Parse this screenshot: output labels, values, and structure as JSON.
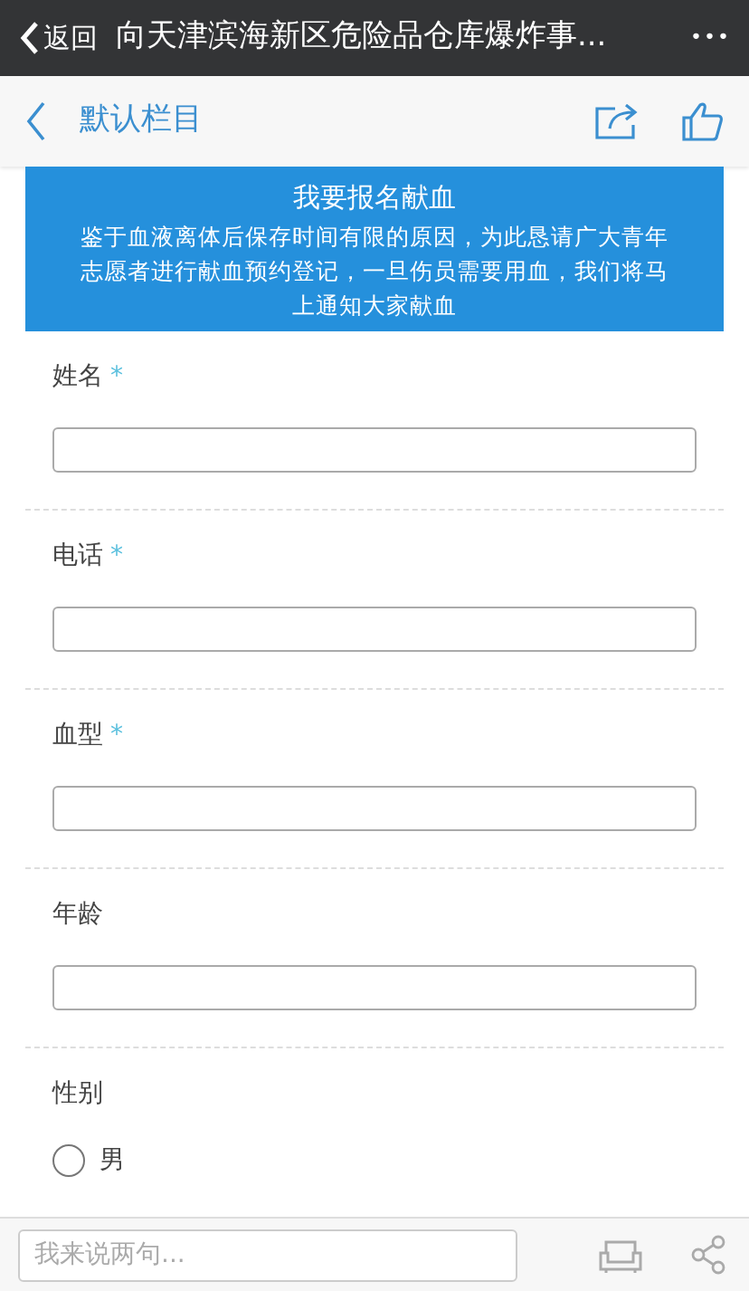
{
  "top_bar": {
    "back_label": "返回",
    "title": "向天津滨海新区危险品仓库爆炸事...",
    "more": "•••"
  },
  "header": {
    "title": "默认栏目"
  },
  "banner": {
    "title": "我要报名献血",
    "text": "鉴于血液离体后保存时间有限的原因，为此恳请广大青年志愿者进行献血预约登记，一旦伤员需要用血，我们将马上通知大家献血"
  },
  "fields": [
    {
      "kind": "text",
      "label": "姓名",
      "required_mark": "*"
    },
    {
      "kind": "text",
      "label": "电话",
      "required_mark": "*"
    },
    {
      "kind": "text",
      "label": "血型",
      "required_mark": "*"
    },
    {
      "kind": "text",
      "label": "年龄"
    },
    {
      "kind": "radio",
      "label": "性别",
      "options": [
        {
          "label": "男",
          "selected": false
        }
      ]
    }
  ],
  "comment_bar": {
    "placeholder": "我来说两句..."
  }
}
